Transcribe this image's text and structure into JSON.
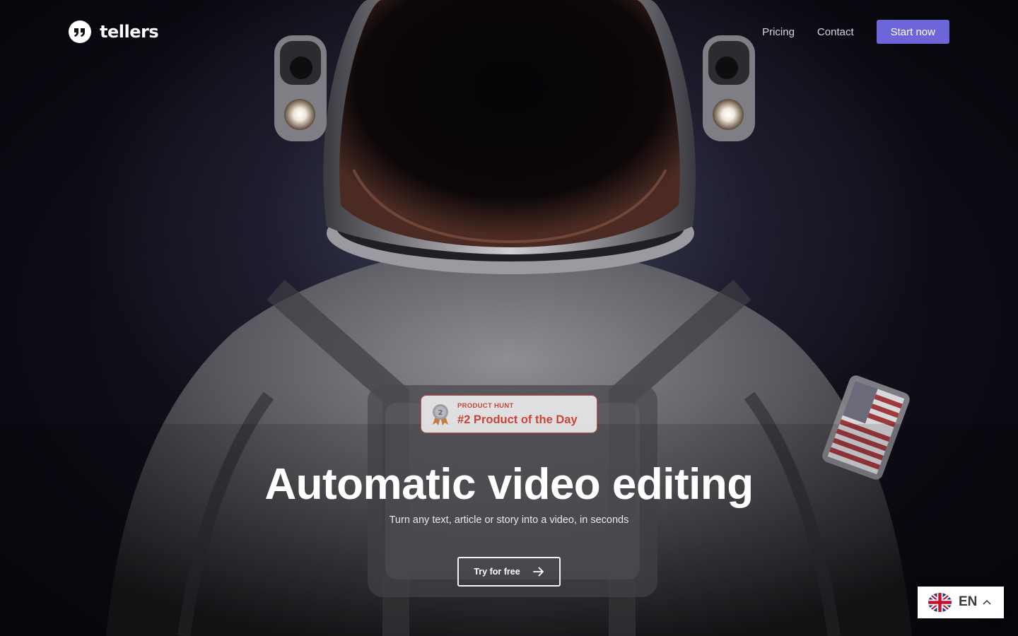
{
  "header": {
    "logo_text": "tellers",
    "nav": [
      {
        "label": "Pricing"
      },
      {
        "label": "Contact"
      }
    ],
    "cta_label": "Start now"
  },
  "badge": {
    "small_label": "PRODUCT HUNT",
    "main_label": "#2 Product of the Day",
    "medal_number": "2"
  },
  "hero": {
    "title": "Automatic video editing",
    "subtitle": "Turn any text, article or story into a video, in seconds",
    "cta_label": "Try for free"
  },
  "language": {
    "code": "EN",
    "flag": "uk-flag-icon"
  },
  "colors": {
    "accent": "#6d66d9",
    "badge_red": "#c8453a",
    "background": "#07060c"
  },
  "icons": {
    "logo": "quote-logo-icon",
    "try_arrow": "arrow-right-icon",
    "medal": "medal-icon",
    "lang_chevron": "chevron-up-icon"
  }
}
